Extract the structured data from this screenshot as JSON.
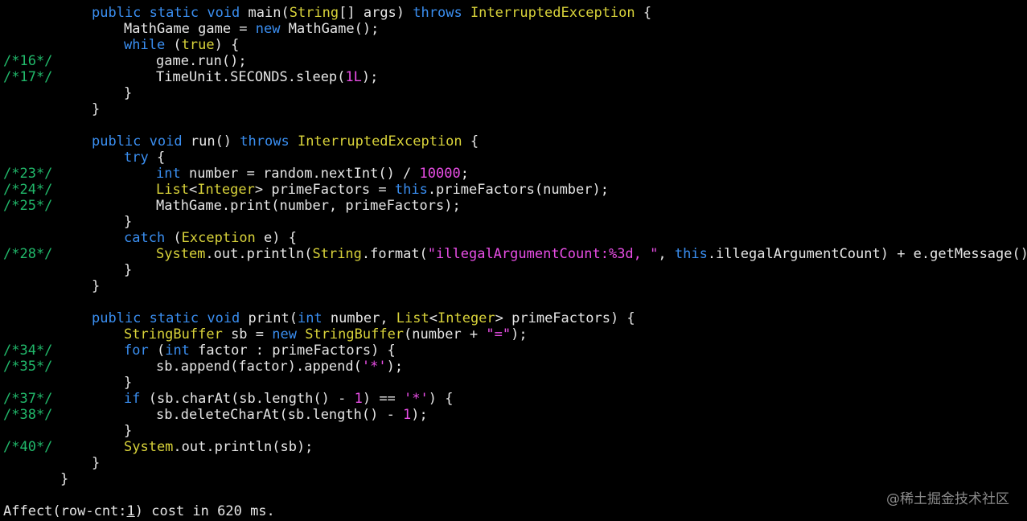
{
  "colors": {
    "background": "#000000",
    "text": "#e6e6e6",
    "keyword": "#3a8ef0",
    "type": "#d8d23a",
    "literal": "#e94ee6",
    "line_number": "#21b96b",
    "watermark": "#8a8a8a"
  },
  "lines": [
    {
      "gutter": "",
      "indent": 2,
      "tokens": [
        [
          "kw",
          "public"
        ],
        [
          "p",
          " "
        ],
        [
          "kw",
          "static"
        ],
        [
          "p",
          " "
        ],
        [
          "kw",
          "void"
        ],
        [
          "p",
          " main("
        ],
        [
          "ty",
          "String"
        ],
        [
          "p",
          "[] args) "
        ],
        [
          "kw",
          "throws"
        ],
        [
          "p",
          " "
        ],
        [
          "ty",
          "InterruptedException"
        ],
        [
          "p",
          " {"
        ]
      ]
    },
    {
      "gutter": "",
      "indent": 3,
      "tokens": [
        [
          "p",
          "MathGame game = "
        ],
        [
          "kw",
          "new"
        ],
        [
          "p",
          " MathGame();"
        ]
      ]
    },
    {
      "gutter": "",
      "indent": 3,
      "tokens": [
        [
          "kw",
          "while"
        ],
        [
          "p",
          " ("
        ],
        [
          "ty",
          "true"
        ],
        [
          "p",
          ") {"
        ]
      ]
    },
    {
      "gutter": "/*16*/",
      "indent": 4,
      "tokens": [
        [
          "p",
          "game.run();"
        ]
      ]
    },
    {
      "gutter": "/*17*/",
      "indent": 4,
      "tokens": [
        [
          "p",
          "TimeUnit.SECONDS.sleep("
        ],
        [
          "num",
          "1L"
        ],
        [
          "p",
          ");"
        ]
      ]
    },
    {
      "gutter": "",
      "indent": 3,
      "tokens": [
        [
          "p",
          "}"
        ]
      ]
    },
    {
      "gutter": "",
      "indent": 2,
      "tokens": [
        [
          "p",
          "}"
        ]
      ]
    },
    {
      "gutter": "",
      "indent": 0,
      "tokens": []
    },
    {
      "gutter": "",
      "indent": 2,
      "tokens": [
        [
          "kw",
          "public"
        ],
        [
          "p",
          " "
        ],
        [
          "kw",
          "void"
        ],
        [
          "p",
          " run() "
        ],
        [
          "kw",
          "throws"
        ],
        [
          "p",
          " "
        ],
        [
          "ty",
          "InterruptedException"
        ],
        [
          "p",
          " {"
        ]
      ]
    },
    {
      "gutter": "",
      "indent": 3,
      "tokens": [
        [
          "kw",
          "try"
        ],
        [
          "p",
          " {"
        ]
      ]
    },
    {
      "gutter": "/*23*/",
      "indent": 4,
      "tokens": [
        [
          "kw",
          "int"
        ],
        [
          "p",
          " number = random.nextInt() / "
        ],
        [
          "num",
          "10000"
        ],
        [
          "p",
          ";"
        ]
      ]
    },
    {
      "gutter": "/*24*/",
      "indent": 4,
      "tokens": [
        [
          "ty",
          "List"
        ],
        [
          "p",
          "<"
        ],
        [
          "ty",
          "Integer"
        ],
        [
          "p",
          "> primeFactors = "
        ],
        [
          "kw",
          "this"
        ],
        [
          "p",
          ".primeFactors(number);"
        ]
      ]
    },
    {
      "gutter": "/*25*/",
      "indent": 4,
      "tokens": [
        [
          "p",
          "MathGame.print(number, primeFactors);"
        ]
      ]
    },
    {
      "gutter": "",
      "indent": 3,
      "tokens": [
        [
          "p",
          "}"
        ]
      ]
    },
    {
      "gutter": "",
      "indent": 3,
      "tokens": [
        [
          "kw",
          "catch"
        ],
        [
          "p",
          " ("
        ],
        [
          "ty",
          "Exception"
        ],
        [
          "p",
          " e) {"
        ]
      ]
    },
    {
      "gutter": "/*28*/",
      "indent": 4,
      "tokens": [
        [
          "ty",
          "System"
        ],
        [
          "p",
          ".out.println("
        ],
        [
          "ty",
          "String"
        ],
        [
          "p",
          ".format("
        ],
        [
          "str",
          "\"illegalArgumentCount:%3d, \""
        ],
        [
          "p",
          ", "
        ],
        [
          "kw",
          "this"
        ],
        [
          "p",
          ".illegalArgumentCount) + e.getMessage());"
        ]
      ]
    },
    {
      "gutter": "",
      "indent": 3,
      "tokens": [
        [
          "p",
          "}"
        ]
      ]
    },
    {
      "gutter": "",
      "indent": 2,
      "tokens": [
        [
          "p",
          "}"
        ]
      ]
    },
    {
      "gutter": "",
      "indent": 0,
      "tokens": []
    },
    {
      "gutter": "",
      "indent": 2,
      "tokens": [
        [
          "kw",
          "public"
        ],
        [
          "p",
          " "
        ],
        [
          "kw",
          "static"
        ],
        [
          "p",
          " "
        ],
        [
          "kw",
          "void"
        ],
        [
          "p",
          " print("
        ],
        [
          "kw",
          "int"
        ],
        [
          "p",
          " number, "
        ],
        [
          "ty",
          "List"
        ],
        [
          "p",
          "<"
        ],
        [
          "ty",
          "Integer"
        ],
        [
          "p",
          "> primeFactors) {"
        ]
      ]
    },
    {
      "gutter": "",
      "indent": 3,
      "tokens": [
        [
          "ty",
          "StringBuffer"
        ],
        [
          "p",
          " sb = "
        ],
        [
          "kw",
          "new"
        ],
        [
          "p",
          " "
        ],
        [
          "ty",
          "StringBuffer"
        ],
        [
          "p",
          "(number + "
        ],
        [
          "str",
          "\"=\""
        ],
        [
          "p",
          ");"
        ]
      ]
    },
    {
      "gutter": "/*34*/",
      "indent": 3,
      "tokens": [
        [
          "kw",
          "for"
        ],
        [
          "p",
          " ("
        ],
        [
          "kw",
          "int"
        ],
        [
          "p",
          " factor : primeFactors) {"
        ]
      ]
    },
    {
      "gutter": "/*35*/",
      "indent": 4,
      "tokens": [
        [
          "p",
          "sb.append(factor).append("
        ],
        [
          "str",
          "'*'"
        ],
        [
          "p",
          ");"
        ]
      ]
    },
    {
      "gutter": "",
      "indent": 3,
      "tokens": [
        [
          "p",
          "}"
        ]
      ]
    },
    {
      "gutter": "/*37*/",
      "indent": 3,
      "tokens": [
        [
          "kw",
          "if"
        ],
        [
          "p",
          " (sb.charAt(sb.length() - "
        ],
        [
          "num",
          "1"
        ],
        [
          "p",
          ") == "
        ],
        [
          "str",
          "'*'"
        ],
        [
          "p",
          ") {"
        ]
      ]
    },
    {
      "gutter": "/*38*/",
      "indent": 4,
      "tokens": [
        [
          "p",
          "sb.deleteCharAt(sb.length() - "
        ],
        [
          "num",
          "1"
        ],
        [
          "p",
          ");"
        ]
      ]
    },
    {
      "gutter": "",
      "indent": 3,
      "tokens": [
        [
          "p",
          "}"
        ]
      ]
    },
    {
      "gutter": "/*40*/",
      "indent": 3,
      "tokens": [
        [
          "ty",
          "System"
        ],
        [
          "p",
          ".out.println(sb);"
        ]
      ]
    },
    {
      "gutter": "",
      "indent": 2,
      "tokens": [
        [
          "p",
          "}"
        ]
      ]
    },
    {
      "gutter": "",
      "indent": 1,
      "tokens": [
        [
          "p",
          "}"
        ]
      ]
    }
  ],
  "status": {
    "before_cursor": "Affect(row-cnt:",
    "cursor_char": "1",
    "after_cursor": ") cost in 620 ms."
  },
  "watermark": "@稀土掘金技术社区"
}
